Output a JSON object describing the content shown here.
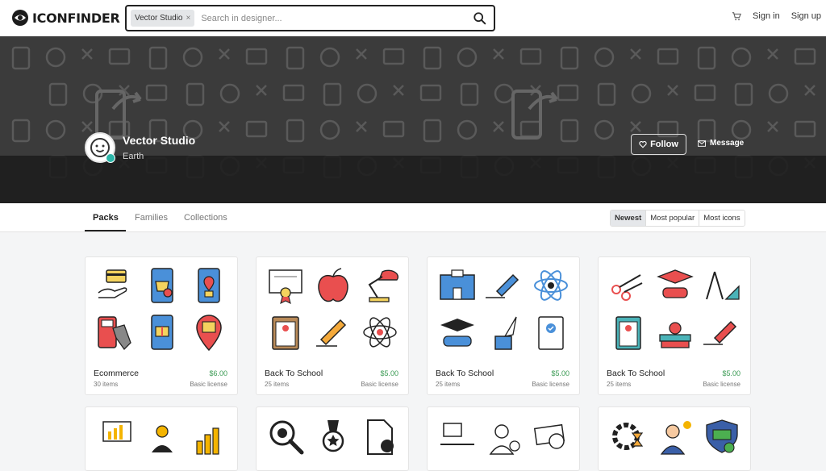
{
  "brand": {
    "name": "ICONFINDER"
  },
  "search": {
    "chip_label": "Vector Studio",
    "chip_remove": "×",
    "placeholder": "Search in designer..."
  },
  "nav": {
    "sign_in": "Sign in",
    "sign_up": "Sign up"
  },
  "designer": {
    "name": "Vector Studio",
    "location": "Earth",
    "follow_label": "Follow",
    "message_label": "Message"
  },
  "tabs": [
    {
      "label": "Packs",
      "active": true
    },
    {
      "label": "Families",
      "active": false
    },
    {
      "label": "Collections",
      "active": false
    }
  ],
  "sort": [
    {
      "label": "Newest",
      "active": true
    },
    {
      "label": "Most popular",
      "active": false
    },
    {
      "label": "Most icons",
      "active": false
    }
  ],
  "packs": [
    {
      "name": "Ecommerce",
      "price": "$6.00",
      "count": "30 items",
      "license": "Basic license"
    },
    {
      "name": "Back To School",
      "price": "$5.00",
      "count": "25 items",
      "license": "Basic license"
    },
    {
      "name": "Back To School",
      "price": "$5.00",
      "count": "25 items",
      "license": "Basic license"
    },
    {
      "name": "Back To School",
      "price": "$5.00",
      "count": "25 items",
      "license": "Basic license"
    }
  ],
  "colors": {
    "accent": "#2bb5a8",
    "price_green": "#3a9a53",
    "hero_bg": "#3b3b3b"
  }
}
